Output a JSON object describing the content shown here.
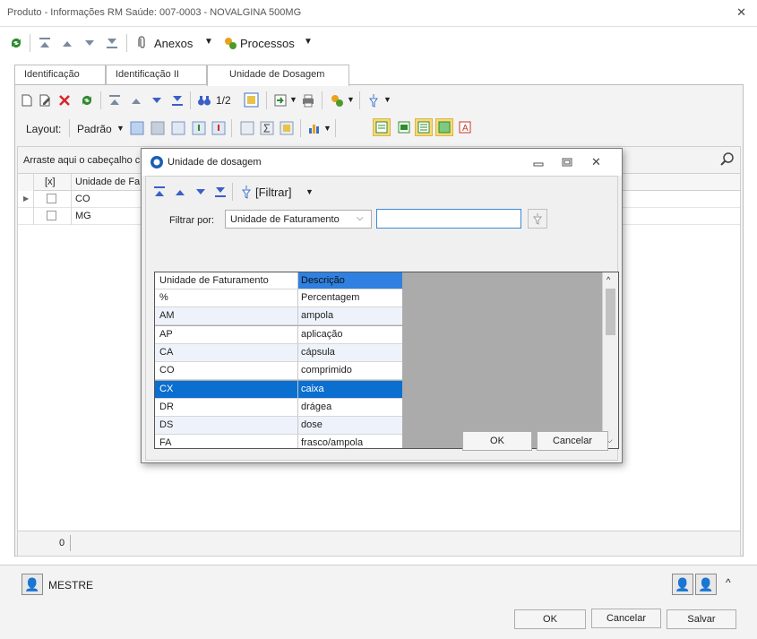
{
  "window": {
    "title": "Produto - Informações RM Saúde: 007-0003 - NOVALGINA 500MG"
  },
  "toolbar": {
    "anexos_label": "Anexos",
    "processos_label": "Processos"
  },
  "tabs": [
    {
      "label": "Identificação"
    },
    {
      "label": "Identificação II"
    },
    {
      "label": "Unidade de Dosagem"
    }
  ],
  "grid_toolbar": {
    "page_indicator": "1/2"
  },
  "layout_bar": {
    "layout_label": "Layout:",
    "padrao_label": "Padrão"
  },
  "grid": {
    "group_hint": "Arraste aqui o cabeçalho c",
    "columns": [
      "[x]",
      "Unidade de Fa"
    ],
    "rows": [
      {
        "value": "CO"
      },
      {
        "value": "MG"
      }
    ],
    "footer_count": "0"
  },
  "dialog": {
    "title": "Unidade de dosagem",
    "filter_menu_label": "[Filtrar]",
    "filter_by_label": "Filtrar por:",
    "filter_by_value": "Unidade de Faturamento",
    "filter_text": "",
    "list_columns": [
      "Unidade de Faturamento",
      "Descrição"
    ],
    "list_rows": [
      {
        "code": "%",
        "desc": "Percentagem"
      },
      {
        "code": "AM",
        "desc": "ampola"
      },
      {
        "code": "AP",
        "desc": "aplicação"
      },
      {
        "code": "CA",
        "desc": "cápsula"
      },
      {
        "code": "CO",
        "desc": "comprimido"
      },
      {
        "code": "CX",
        "desc": "caixa"
      },
      {
        "code": "DR",
        "desc": "drágea"
      },
      {
        "code": "DS",
        "desc": "dose"
      },
      {
        "code": "FA",
        "desc": "frasco/ampola"
      }
    ],
    "selected_code": "CX",
    "ok_label": "OK",
    "cancel_label": "Cancelar"
  },
  "bottom": {
    "user_label": "MESTRE",
    "ok_label": "OK",
    "cancel_label": "Cancelar",
    "save_label": "Salvar"
  },
  "colors": {
    "accent": "#0a6fcf",
    "header_selected": "#2f80e0",
    "list_bg": "#ababab"
  }
}
